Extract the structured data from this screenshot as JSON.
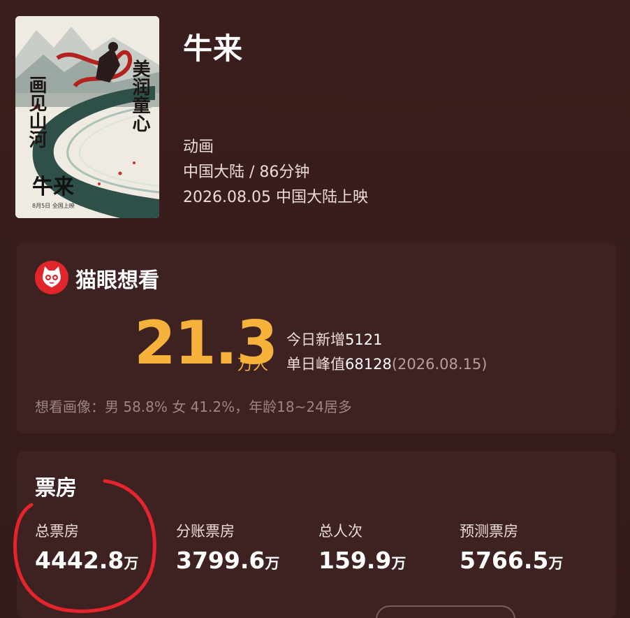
{
  "movie": {
    "title": "牛来",
    "genre": "动画",
    "region_duration": "中国大陆 / 86分钟",
    "release": "2026.08.05 中国大陆上映",
    "poster_text": {
      "left_vertical": "画见山河",
      "right_vertical": "美润童心",
      "title": "牛来",
      "date_line": "8月5日  全国上映"
    }
  },
  "want_to_see": {
    "brand": "猫眼想看",
    "total_value": "21.3",
    "total_unit": "万人",
    "today_label": "今日新增",
    "today_value": "5121",
    "peak_label": "单日峰值",
    "peak_value": "68128",
    "peak_date": "(2026.08.15)",
    "portrait": "想看画像：男 58.8% 女 41.2%，年龄18~24居多"
  },
  "box_office": {
    "title": "票房",
    "items": [
      {
        "label": "总票房",
        "value": "4442.8",
        "unit": "万"
      },
      {
        "label": "分账票房",
        "value": "3799.6",
        "unit": "万"
      },
      {
        "label": "总人次",
        "value": "159.9",
        "unit": "万"
      },
      {
        "label": "预测票房",
        "value": "5766.5",
        "unit": "万"
      }
    ]
  },
  "colors": {
    "background": "#351c1b",
    "card": "#3d2221",
    "accent": "#f7b23b",
    "maoyan_red": "#e0262a",
    "annotation_red": "#e5242b"
  },
  "icons": [
    "maoyan-cat-icon"
  ]
}
